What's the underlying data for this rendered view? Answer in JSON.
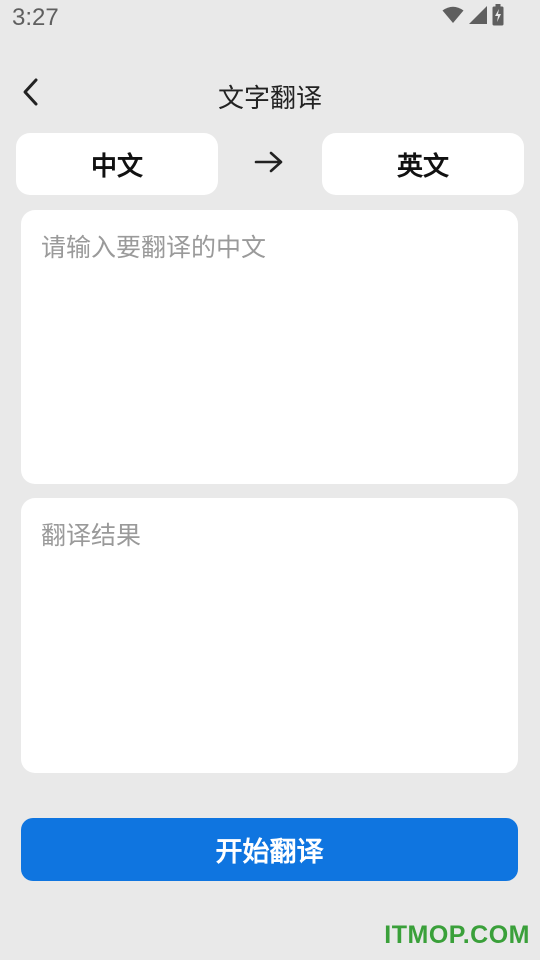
{
  "status_bar": {
    "time": "3:27",
    "icons": [
      "wifi-icon",
      "cell-signal-icon",
      "battery-charging-icon"
    ]
  },
  "toolbar": {
    "back_icon": "chevron-left-icon",
    "title": "文字翻译"
  },
  "language_selector": {
    "source": "中文",
    "target": "英文",
    "direction_icon": "arrow-right-icon"
  },
  "input": {
    "placeholder": "请输入要翻译的中文",
    "value": ""
  },
  "output": {
    "placeholder": "翻译结果"
  },
  "action": {
    "label": "开始翻译"
  },
  "watermark": "ITMOP.COM",
  "colors": {
    "background": "#e9e9e9",
    "card": "#ffffff",
    "primary": "#0f75e0",
    "watermark": "#3aa03a",
    "placeholder": "#9a9a9a"
  }
}
